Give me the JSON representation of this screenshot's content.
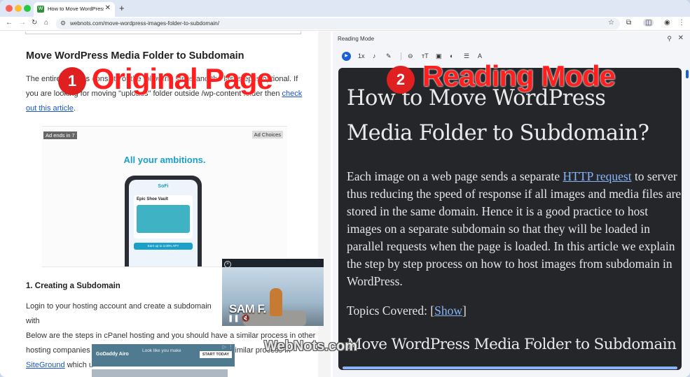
{
  "browser": {
    "tab_title": "How to Move WordPress Images Folder to Subdomain",
    "tab_favicon": "W",
    "url": "webnots.com/move-wordpress-images-folder-to-subdomain/",
    "new_tab_label": "+",
    "tab_close_label": "✕"
  },
  "page": {
    "article_title": "Move WordPress Media Folder to Subdomain",
    "para_text": "The entire process consists of the following steps and the last step is optional. If you are looking for moving \"uploads\" folder outside /wp-content folder then ",
    "para_link": "check out this article",
    "para_end": ".",
    "ad": {
      "ends_label": "Ad ends in 7",
      "choices_label": "Ad Choices",
      "headline": "All your ambitions.",
      "brand": "SoFi",
      "card_label": "Epic Shoe Vault",
      "button_label": "Earn up to 4.00% APY"
    },
    "section_heading": "1. Creating a Subdomain",
    "section_para": "Login to your hosting account and create a subdomain with",
    "section_para2_text": "Below are the steps in cPanel hosting and you should have a similar process in other hosting companies as well. For example, you can follow the similar process in ",
    "section_para2_link": "SiteGround",
    "section_para2_end": " which u"
  },
  "video": {
    "overlay_text": "SAM F.",
    "close_label": "×",
    "controls_label": "❚❚  🔇"
  },
  "banner": {
    "logo": "GoDaddy Airo",
    "text": "Look like you make",
    "button": "START TODAY",
    "adchoice": "▷",
    "dots": "⋮"
  },
  "reading_mode": {
    "panel_title": "Reading Mode",
    "speed_label": "1x",
    "doc_title": "How to Move WordPress Media Folder to Subdomain?",
    "para_before_link": "Each image on a web page sends a separate ",
    "para_link": "HTTP request",
    "para_after_link": " to server thus reducing the speed of response if all images and media files are stored in the same domain. Hence it is a good practice to host images on a separate subdomain so that they will be loaded in parallel requests when the page is loaded. In this article we explain the step by step process on how to host images from subdomain in WordPress.",
    "topics_prefix": "Topics Covered: [",
    "topics_link": "Show",
    "topics_suffix": "]",
    "section_heading": "Move WordPress Media Folder to Subdomain"
  },
  "annotations": {
    "left_number": "1",
    "left_label": "Original Page",
    "right_number": "2",
    "right_label": "Reading Mode"
  },
  "watermark": "WebNots.com",
  "colors": {
    "accent": "#1a5fd6",
    "annotation_red": "#e02020",
    "reading_bg": "#242629",
    "link_blue": "#1a56c8"
  }
}
